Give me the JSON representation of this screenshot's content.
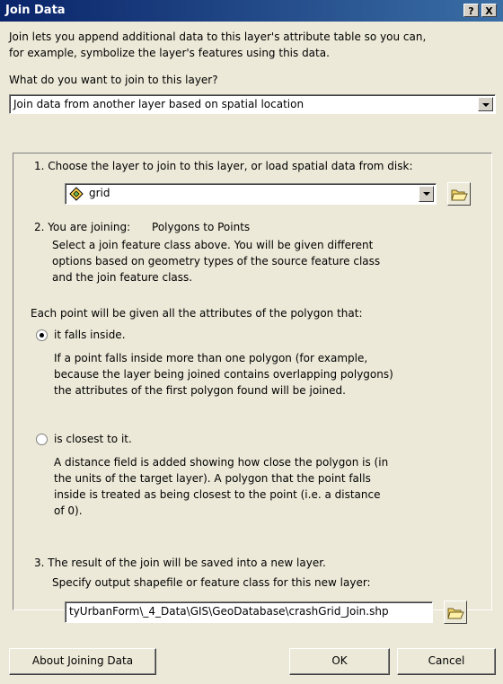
{
  "window": {
    "title": "Join Data",
    "help_button": "?",
    "close_button": "X"
  },
  "intro": {
    "line1": "Join lets you append additional data to this layer's attribute table so you can,",
    "line2": "for example, symbolize the layer's features using this data."
  },
  "question": {
    "label": "What do you want to join to this layer?"
  },
  "join_type": {
    "value": "Join data from another layer based on spatial location"
  },
  "step1": {
    "label": "1.  Choose the layer to join to this layer, or load spatial data from disk:",
    "layer_value": "grid"
  },
  "step2": {
    "label_prefix": "2.  You are joining:",
    "label_value": "Polygons to Points",
    "desc1": "Select a join feature class above.  You will be given different",
    "desc2": "options based on geometry types of the source feature class",
    "desc3": "and the join feature class."
  },
  "point_rule": {
    "label": "Each point will be given all the attributes of the polygon that:"
  },
  "option_inside": {
    "label": "it falls inside.",
    "selected": true,
    "desc1": "If a point falls inside more than one polygon (for example,",
    "desc2": "because the layer being joined contains overlapping polygons)",
    "desc3": "the attributes of the first polygon found will be joined."
  },
  "option_closest": {
    "label": "is closest to it.",
    "selected": false,
    "desc1": "A distance field is added showing how close the polygon is (in",
    "desc2": "the units of the target layer). A polygon that the point falls",
    "desc3": "inside is treated as being closest to the point (i.e. a distance",
    "desc4": "of 0)."
  },
  "step3": {
    "label": "3.  The result of the join will be saved into a new layer.",
    "output_label": "Specify output shapefile or feature class for this new layer:",
    "output_value": "tyUrbanForm\\_4_Data\\GIS\\GeoDatabase\\crashGrid_Join.shp"
  },
  "buttons": {
    "about": "About Joining Data",
    "ok": "OK",
    "cancel": "Cancel"
  },
  "icons": {
    "folder": "folder-open-icon",
    "layer": "polygon-layer-icon"
  },
  "colors": {
    "titlebar": "#0a246a",
    "face": "#ece9d8"
  }
}
